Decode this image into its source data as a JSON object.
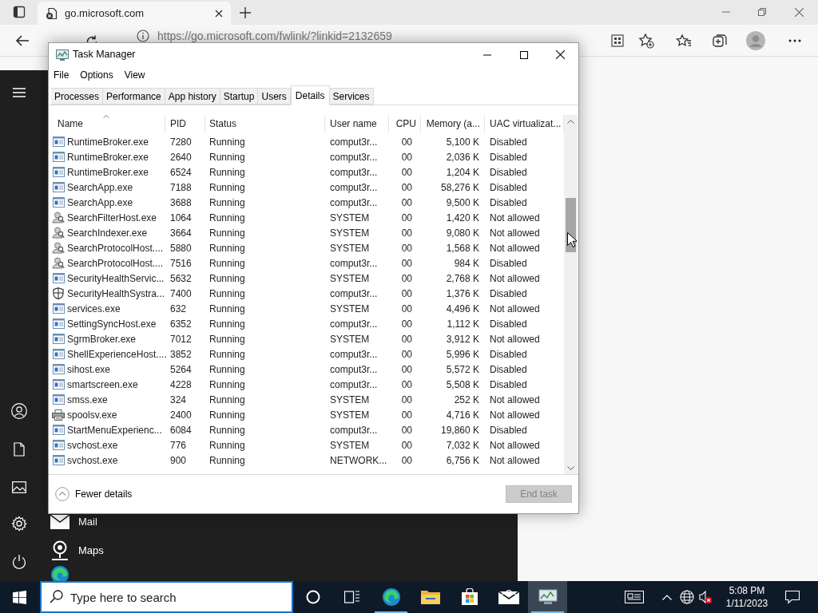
{
  "browser": {
    "tab_title": "go.microsoft.com",
    "url": "https://go.microsoft.com/fwlink/?linkid=2132659"
  },
  "start_menu": {
    "apps": [
      {
        "kind": "mail",
        "label": "Mail"
      },
      {
        "kind": "maps",
        "label": "Maps"
      }
    ]
  },
  "task_manager": {
    "title": "Task Manager",
    "menu": [
      "File",
      "Options",
      "View"
    ],
    "tabs": [
      {
        "label": "Processes",
        "selected": false
      },
      {
        "label": "Performance",
        "selected": false
      },
      {
        "label": "App history",
        "selected": false
      },
      {
        "label": "Startup",
        "selected": false
      },
      {
        "label": "Users",
        "selected": false
      },
      {
        "label": "Details",
        "selected": true
      },
      {
        "label": "Services",
        "selected": false
      }
    ],
    "columns": [
      "Name",
      "PID",
      "Status",
      "User name",
      "CPU",
      "Memory (a...",
      "UAC virtualizat..."
    ],
    "rows": [
      {
        "kind": "app",
        "name": "RuntimeBroker.exe",
        "pid": "7280",
        "status": "Running",
        "user": "comput3r...",
        "cpu": "00",
        "memory": "5,100 K",
        "uac": "Disabled"
      },
      {
        "kind": "app",
        "name": "RuntimeBroker.exe",
        "pid": "2640",
        "status": "Running",
        "user": "comput3r...",
        "cpu": "00",
        "memory": "2,036 K",
        "uac": "Disabled"
      },
      {
        "kind": "app",
        "name": "RuntimeBroker.exe",
        "pid": "6524",
        "status": "Running",
        "user": "comput3r...",
        "cpu": "00",
        "memory": "1,204 K",
        "uac": "Disabled"
      },
      {
        "kind": "app",
        "name": "SearchApp.exe",
        "pid": "7188",
        "status": "Running",
        "user": "comput3r...",
        "cpu": "00",
        "memory": "58,276 K",
        "uac": "Disabled"
      },
      {
        "kind": "app",
        "name": "SearchApp.exe",
        "pid": "3688",
        "status": "Running",
        "user": "comput3r...",
        "cpu": "00",
        "memory": "9,500 K",
        "uac": "Disabled"
      },
      {
        "kind": "search",
        "name": "SearchFilterHost.exe",
        "pid": "1064",
        "status": "Running",
        "user": "SYSTEM",
        "cpu": "00",
        "memory": "1,420 K",
        "uac": "Not allowed"
      },
      {
        "kind": "search",
        "name": "SearchIndexer.exe",
        "pid": "3664",
        "status": "Running",
        "user": "SYSTEM",
        "cpu": "00",
        "memory": "9,080 K",
        "uac": "Not allowed"
      },
      {
        "kind": "search",
        "name": "SearchProtocolHost....",
        "pid": "5880",
        "status": "Running",
        "user": "SYSTEM",
        "cpu": "00",
        "memory": "1,568 K",
        "uac": "Not allowed"
      },
      {
        "kind": "search",
        "name": "SearchProtocolHost....",
        "pid": "7516",
        "status": "Running",
        "user": "comput3r...",
        "cpu": "00",
        "memory": "984 K",
        "uac": "Disabled"
      },
      {
        "kind": "app",
        "name": "SecurityHealthServic...",
        "pid": "5632",
        "status": "Running",
        "user": "SYSTEM",
        "cpu": "00",
        "memory": "2,768 K",
        "uac": "Not allowed"
      },
      {
        "kind": "shield",
        "name": "SecurityHealthSystra...",
        "pid": "7400",
        "status": "Running",
        "user": "comput3r...",
        "cpu": "00",
        "memory": "1,376 K",
        "uac": "Disabled"
      },
      {
        "kind": "app",
        "name": "services.exe",
        "pid": "632",
        "status": "Running",
        "user": "SYSTEM",
        "cpu": "00",
        "memory": "4,496 K",
        "uac": "Not allowed"
      },
      {
        "kind": "app",
        "name": "SettingSyncHost.exe",
        "pid": "6352",
        "status": "Running",
        "user": "comput3r...",
        "cpu": "00",
        "memory": "1,112 K",
        "uac": "Disabled"
      },
      {
        "kind": "app",
        "name": "SgrmBroker.exe",
        "pid": "7012",
        "status": "Running",
        "user": "SYSTEM",
        "cpu": "00",
        "memory": "3,912 K",
        "uac": "Not allowed"
      },
      {
        "kind": "app",
        "name": "ShellExperienceHost....",
        "pid": "3852",
        "status": "Running",
        "user": "comput3r...",
        "cpu": "00",
        "memory": "5,996 K",
        "uac": "Disabled"
      },
      {
        "kind": "app",
        "name": "sihost.exe",
        "pid": "5264",
        "status": "Running",
        "user": "comput3r...",
        "cpu": "00",
        "memory": "5,572 K",
        "uac": "Disabled"
      },
      {
        "kind": "app",
        "name": "smartscreen.exe",
        "pid": "4228",
        "status": "Running",
        "user": "comput3r...",
        "cpu": "00",
        "memory": "5,508 K",
        "uac": "Disabled"
      },
      {
        "kind": "app",
        "name": "smss.exe",
        "pid": "324",
        "status": "Running",
        "user": "SYSTEM",
        "cpu": "00",
        "memory": "252 K",
        "uac": "Not allowed"
      },
      {
        "kind": "printer",
        "name": "spoolsv.exe",
        "pid": "2400",
        "status": "Running",
        "user": "SYSTEM",
        "cpu": "00",
        "memory": "4,716 K",
        "uac": "Not allowed"
      },
      {
        "kind": "app",
        "name": "StartMenuExperienc...",
        "pid": "6084",
        "status": "Running",
        "user": "comput3r...",
        "cpu": "00",
        "memory": "19,860 K",
        "uac": "Disabled"
      },
      {
        "kind": "app",
        "name": "svchost.exe",
        "pid": "776",
        "status": "Running",
        "user": "SYSTEM",
        "cpu": "00",
        "memory": "7,032 K",
        "uac": "Not allowed"
      },
      {
        "kind": "app",
        "name": "svchost.exe",
        "pid": "900",
        "status": "Running",
        "user": "NETWORK...",
        "cpu": "00",
        "memory": "6,756 K",
        "uac": "Not allowed"
      }
    ],
    "fewer_details": "Fewer details",
    "end_task": {
      "label": "End task",
      "disabled": true
    }
  },
  "taskbar": {
    "search_placeholder": "Type here to search",
    "apps": [
      {
        "kind": "cortana",
        "running": false,
        "selected": false
      },
      {
        "kind": "taskview",
        "running": false,
        "selected": false
      },
      {
        "kind": "edge",
        "running": true,
        "selected": false
      },
      {
        "kind": "explorer",
        "running": false,
        "selected": false
      },
      {
        "kind": "store",
        "running": false,
        "selected": false
      },
      {
        "kind": "mail",
        "running": false,
        "selected": false
      },
      {
        "kind": "taskmanager",
        "running": true,
        "selected": true
      }
    ],
    "time": "5:08 PM",
    "date": "1/11/2023"
  }
}
